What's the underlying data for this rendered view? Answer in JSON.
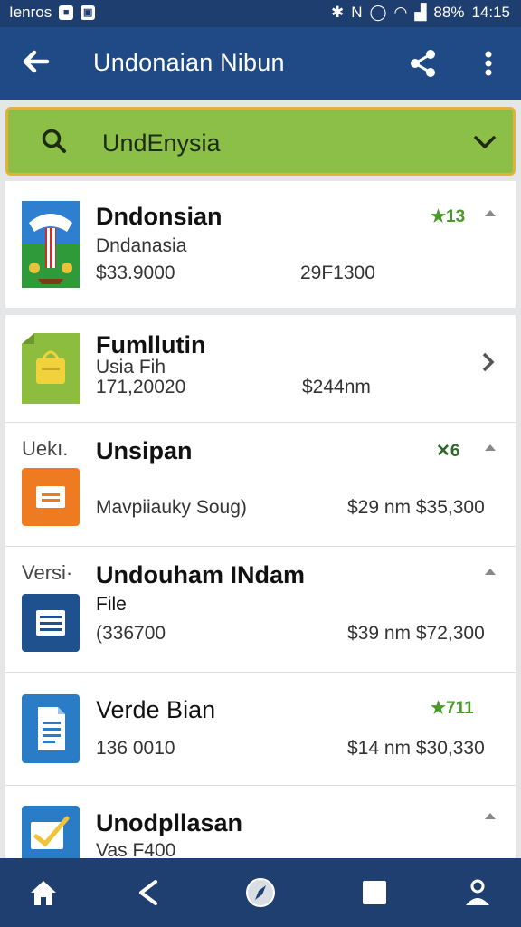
{
  "status": {
    "left_text": "Ienros",
    "battery": "88%",
    "time": "14:15"
  },
  "appbar": {
    "title": "Undonaian Nibun"
  },
  "search": {
    "value": "UndEnysia"
  },
  "items": [
    {
      "title": "Dndonsian",
      "line1": "Dndanasia",
      "line2_left": "$33.9000",
      "line2_right": "29F1300",
      "rating": "★13",
      "icon": "flag-emblem-icon"
    },
    {
      "title": "Fumllutin",
      "line1": "Usia Fih",
      "line2_left": "171,20020",
      "line2_right": "$244nm",
      "icon": "shopping-bag-icon"
    },
    {
      "prefix": "Uekı.",
      "title": "Unsipan",
      "line2_left": "Mavpiiauky Soug)",
      "line2_right": "$29 nm $35,300",
      "rating": "✕6",
      "icon": "slides-icon"
    },
    {
      "prefix": "Versi·",
      "title": "Undouham INdam",
      "line1": "File",
      "line2_left": "(336700",
      "line2_right": "$39 nm $72,300",
      "icon": "doc-list-icon"
    },
    {
      "title": "Verde Bian",
      "line2_left": "136 0010",
      "line2_right": "$14 nm $30,330",
      "rating": "★711",
      "icon": "document-icon"
    },
    {
      "title": "Unodpllasan",
      "line1": "Vas F400",
      "icon": "edit-check-icon"
    }
  ],
  "colors": {
    "statusbar": "#1e3e6f",
    "appbar": "#1f4a86",
    "search_bg": "#8cbf48",
    "search_border": "#e3b23a",
    "rating_green": "#4a9a2a",
    "nav": "#1f3f70"
  }
}
